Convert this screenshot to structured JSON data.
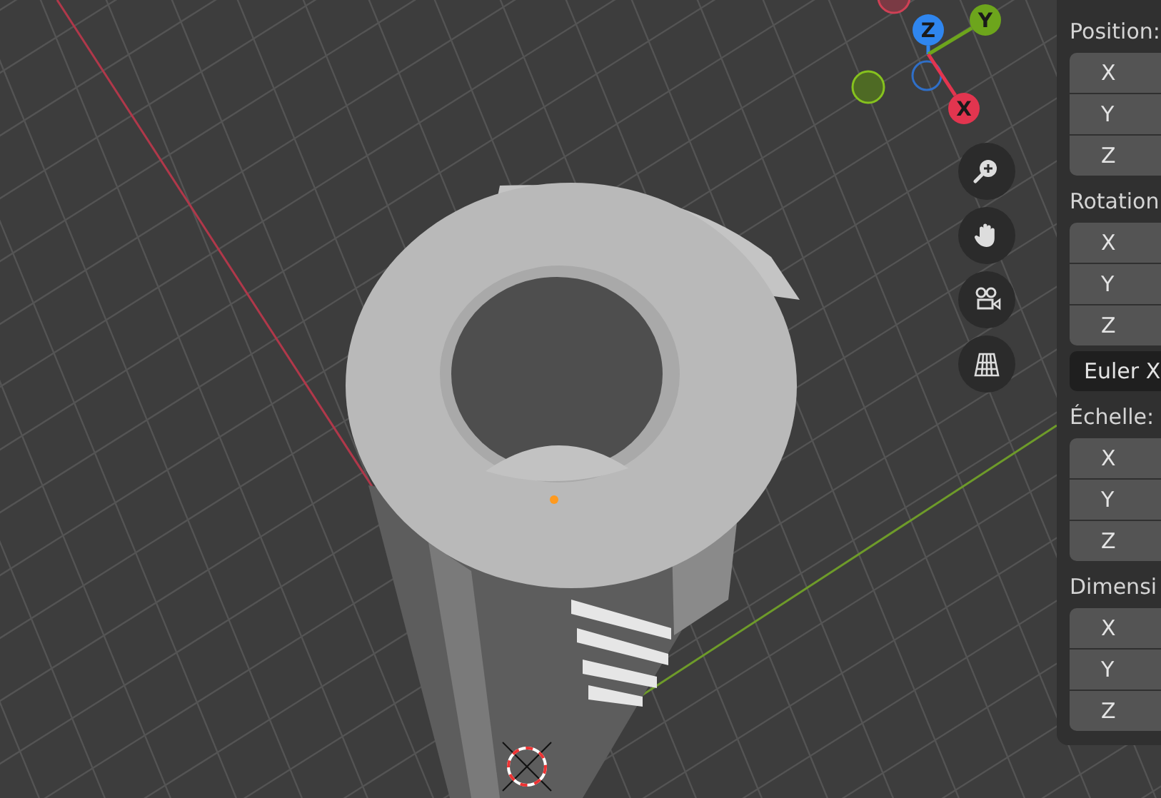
{
  "gizmo": {
    "axes": [
      {
        "label": "Z",
        "color": "#2f86ef"
      },
      {
        "label": "Y",
        "color": "#6da51c"
      },
      {
        "label": "X",
        "color": "#e2354f"
      }
    ]
  },
  "nav_buttons": [
    {
      "kind": "zoom"
    },
    {
      "kind": "pan"
    },
    {
      "kind": "camera"
    },
    {
      "kind": "perspective"
    }
  ],
  "panel": {
    "sections": [
      {
        "title": "Position:",
        "fields": [
          "X",
          "Y",
          "Z"
        ]
      },
      {
        "title": "Rotation",
        "fields": [
          "X",
          "Y",
          "Z"
        ],
        "mode": "Euler X"
      },
      {
        "title": "Échelle:",
        "fields": [
          "X",
          "Y",
          "Z"
        ]
      },
      {
        "title": "Dimensi",
        "fields": [
          "X",
          "Y",
          "Z"
        ]
      }
    ]
  }
}
